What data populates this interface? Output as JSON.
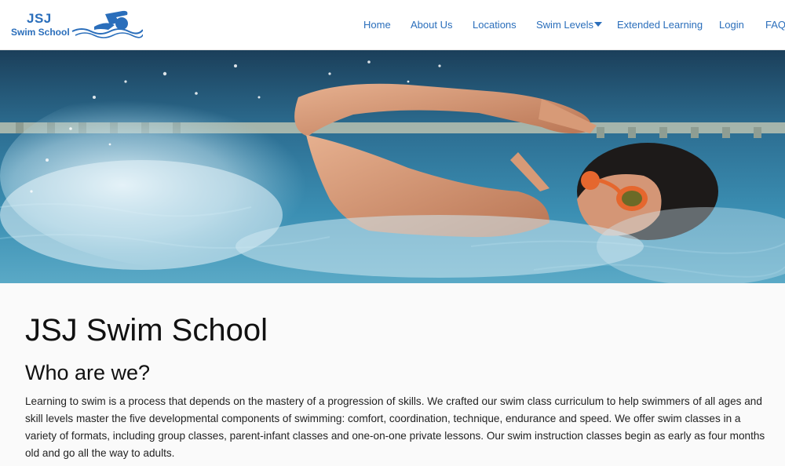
{
  "brand": {
    "line1": "JSJ",
    "line2": "Swim School"
  },
  "nav": {
    "home": "Home",
    "about": "About Us",
    "locations": "Locations",
    "swim_levels": "Swim Levels",
    "extended": "Extended Learning",
    "login": "Login",
    "faq": "FAQ"
  },
  "main": {
    "title": "JSJ Swim School",
    "subtitle": "Who are we?",
    "body": "Learning to swim is a process that depends on the mastery of a progression of skills. We crafted our swim class curriculum to help swimmers of all ages and skill levels master the five developmental components of swimming: comfort, coordination, technique, endurance and speed. We offer swim classes in a variety of formats, including group classes, parent-infant classes and one-on-one private lessons. Our swim instruction classes begin as early as four months old and go all the way to adults."
  },
  "colors": {
    "brand_blue": "#2a6ebb",
    "water": "#2d7fa8",
    "background": "#fafafa"
  },
  "icons": {
    "logo_swimmer": "swimmer-logo-icon",
    "dropdown": "caret-down-icon"
  }
}
